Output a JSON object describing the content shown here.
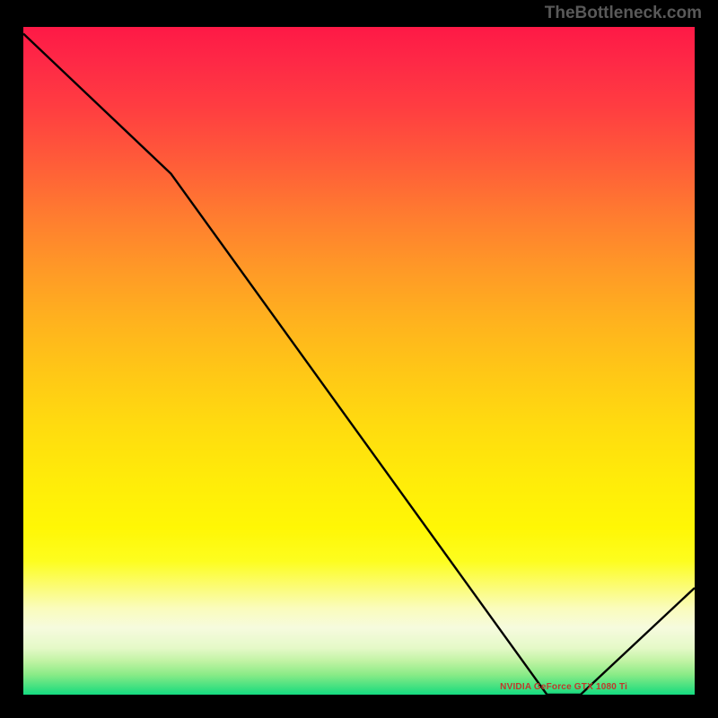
{
  "attribution": "TheBottleneck.com",
  "colors": {
    "background": "#000000",
    "line": "#000000",
    "annotation": "#c0392b"
  },
  "chart_data": {
    "type": "line",
    "x_range": [
      0,
      100
    ],
    "y_range": [
      0,
      100
    ],
    "points": [
      {
        "x": 0,
        "y": 99
      },
      {
        "x": 22,
        "y": 78
      },
      {
        "x": 78,
        "y": 0
      },
      {
        "x": 83,
        "y": 0
      },
      {
        "x": 100,
        "y": 16
      }
    ],
    "annotation": {
      "text": "NVIDIA GeForce GTX 1080 Ti",
      "x": 80.5,
      "y": 0.5
    },
    "title": "",
    "xlabel": "",
    "ylabel": "",
    "grid": false,
    "legend": false
  }
}
